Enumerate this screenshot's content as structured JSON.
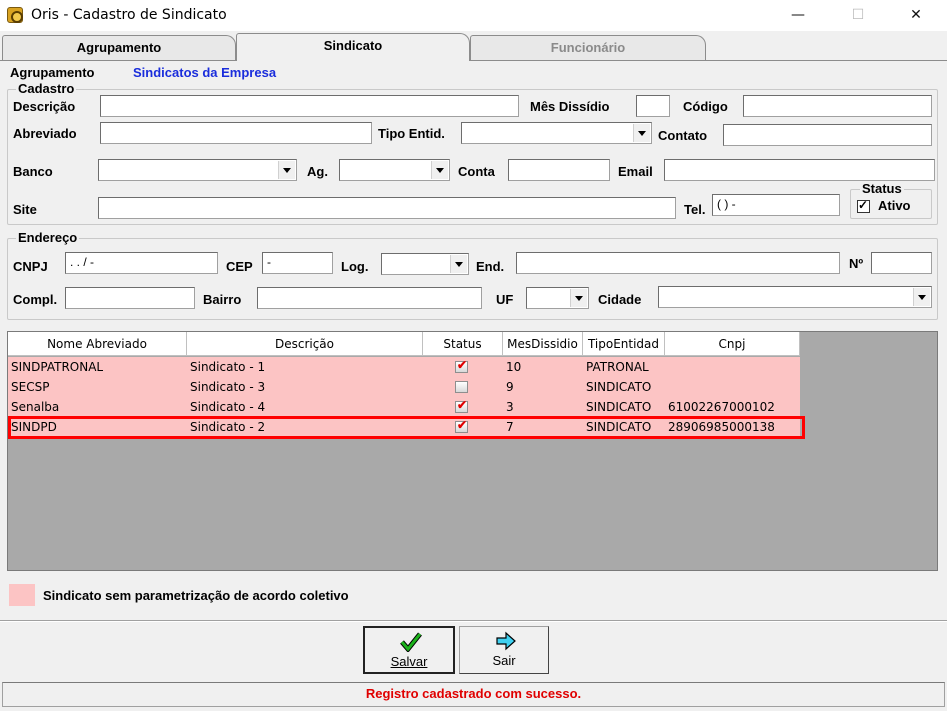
{
  "window": {
    "title": "Oris - Cadastro de Sindicato",
    "minimize": "—",
    "maximize": "☐",
    "close": "✕"
  },
  "tabs": [
    {
      "label": "Agrupamento"
    },
    {
      "label": "Sindicato"
    },
    {
      "label": "Funcionário"
    }
  ],
  "header": {
    "agrupamento_label": "Agrupamento",
    "agrupamento_value": "Sindicatos da Empresa"
  },
  "cadastro": {
    "group_title": "Cadastro",
    "descricao_label": "Descrição",
    "descricao_value": "",
    "mes_dissidio_label": "Mês Dissídio",
    "mes_dissidio_value": "",
    "codigo_label": "Código",
    "codigo_value": "",
    "abreviado_label": "Abreviado",
    "abreviado_value": "",
    "tipo_entid_label": "Tipo Entid.",
    "tipo_entid_value": "",
    "contato_label": "Contato",
    "contato_value": "",
    "banco_label": "Banco",
    "banco_value": "",
    "ag_label": "Ag.",
    "ag_value": "",
    "conta_label": "Conta",
    "conta_value": "",
    "email_label": "Email",
    "email_value": "",
    "site_label": "Site",
    "site_value": "",
    "tel_label": "Tel.",
    "tel_value": "(  )      -",
    "status_title": "Status",
    "ativo_label": "Ativo",
    "ativo_checked": true
  },
  "endereco": {
    "group_title": "Endereço",
    "cnpj_label": "CNPJ",
    "cnpj_value": "  .   .   /    -",
    "cep_label": "CEP",
    "cep_value": "     -",
    "log_label": "Log.",
    "log_value": "",
    "end_label": "End.",
    "end_value": "",
    "numero_label": "Nº",
    "numero_value": "",
    "compl_label": "Compl.",
    "compl_value": "",
    "bairro_label": "Bairro",
    "bairro_value": "",
    "uf_label": "UF",
    "uf_value": "",
    "cidade_label": "Cidade",
    "cidade_value": ""
  },
  "grid": {
    "columns": [
      "Nome Abreviado",
      "Descrição",
      "Status",
      "MesDissidio",
      "TipoEntidad",
      "Cnpj"
    ],
    "rows": [
      {
        "nome": "SINDPATRONAL",
        "descricao": "Sindicato - 1",
        "status": true,
        "mes": "10",
        "tipo": "PATRONAL",
        "cnpj": ""
      },
      {
        "nome": "SECSP",
        "descricao": "Sindicato - 3",
        "status": false,
        "mes": "9",
        "tipo": "SINDICATO",
        "cnpj": ""
      },
      {
        "nome": "Senalba",
        "descricao": "Sindicato - 4",
        "status": true,
        "mes": "3",
        "tipo": "SINDICATO",
        "cnpj": "61002267000102"
      },
      {
        "nome": "SINDPD",
        "descricao": "Sindicato - 2",
        "status": true,
        "mes": "7",
        "tipo": "SINDICATO",
        "cnpj": "28906985000138"
      }
    ],
    "highlighted_row": 3
  },
  "legend": {
    "text": "Sindicato sem parametrização de acordo coletivo",
    "color": "#fcc4c4"
  },
  "buttons": {
    "salvar": "Salvar",
    "sair": "Sair"
  },
  "statusbar": {
    "message": "Registro cadastrado com sucesso.",
    "color": "#e00000"
  }
}
